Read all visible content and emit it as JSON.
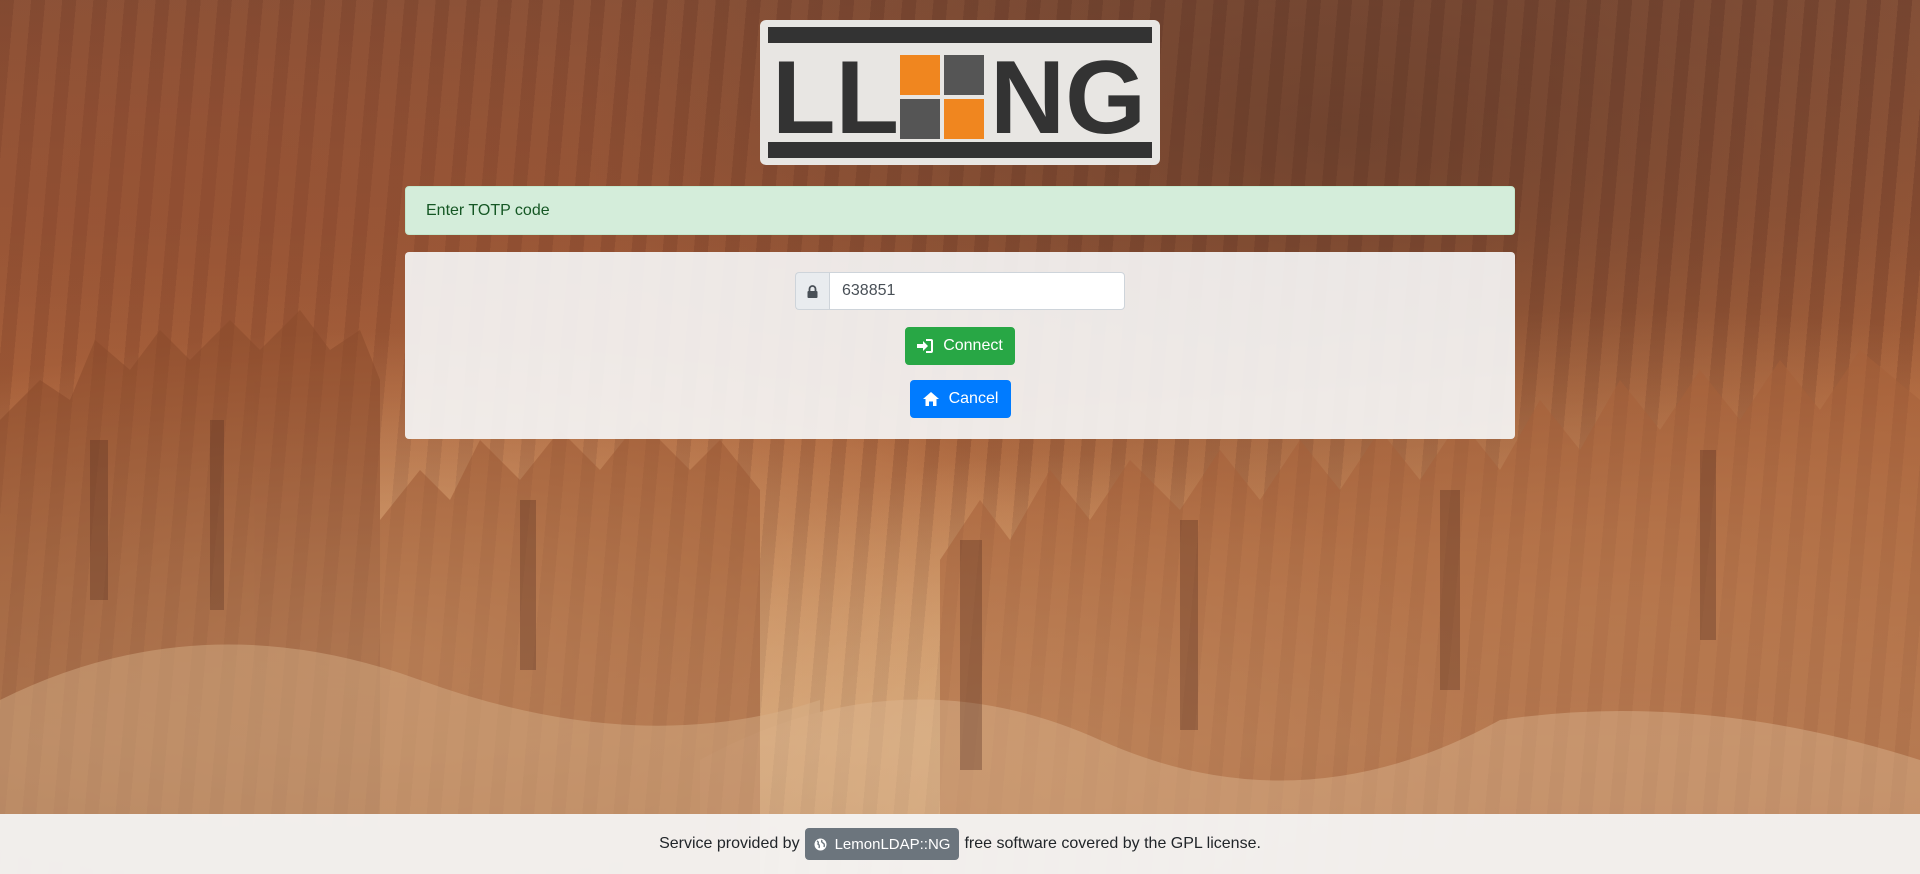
{
  "logo": {
    "text": "LLNG",
    "accent_color": "#f0861f",
    "dark_color": "#333333"
  },
  "alert": {
    "message": "Enter TOTP code",
    "color": "#d4edda"
  },
  "form": {
    "totp_value": "638851",
    "lock_icon": "lock-icon",
    "connect_label": "Connect",
    "connect_icon": "sign-in-icon",
    "cancel_label": "Cancel",
    "cancel_icon": "home-icon"
  },
  "footer": {
    "prefix": "Service provided by",
    "badge_label": "LemonLDAP::NG",
    "badge_icon": "globe-icon",
    "suffix": "free software covered by the GPL license."
  },
  "colors": {
    "success": "#28a745",
    "primary": "#007bff",
    "secondary": "#6c757d"
  }
}
